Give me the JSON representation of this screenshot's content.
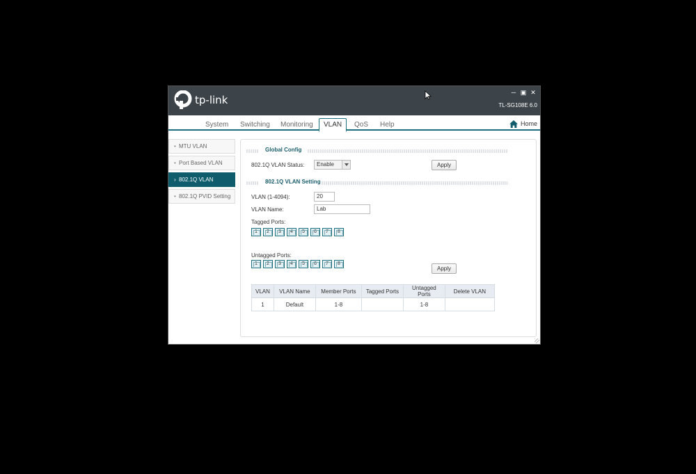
{
  "app": {
    "logo_text": "tp-link",
    "model": "TL-SG108E 6.0",
    "window_controls": [
      "minimize-icon",
      "maximize-icon",
      "close-icon"
    ]
  },
  "nav": {
    "tabs": [
      {
        "label": "System",
        "active": false
      },
      {
        "label": "Switching",
        "active": false
      },
      {
        "label": "Monitoring",
        "active": false
      },
      {
        "label": "VLAN",
        "active": true
      },
      {
        "label": "QoS",
        "active": false
      },
      {
        "label": "Help",
        "active": false
      }
    ],
    "home_label": "Home"
  },
  "sidebar": {
    "items": [
      {
        "label": "MTU VLAN",
        "active": false
      },
      {
        "label": "Port Based VLAN",
        "active": false
      },
      {
        "label": "802.1Q VLAN",
        "active": true
      },
      {
        "label": "802.1Q PVID Setting",
        "active": false
      }
    ]
  },
  "global_config": {
    "title": "Global Config",
    "status_label": "802.1Q VLAN Status:",
    "status_value": "Enable",
    "apply_label": "Apply"
  },
  "vlan_setting": {
    "title": "802.1Q VLAN Setting",
    "vlan_id_label": "VLAN (1-4094):",
    "vlan_id_value": "20",
    "vlan_name_label": "VLAN Name:",
    "vlan_name_value": "Lab",
    "tagged_label": "Tagged Ports:",
    "tagged_ports": [
      "1",
      "2",
      "3",
      "4",
      "5",
      "6",
      "7",
      "8"
    ],
    "untagged_label": "Untagged Ports:",
    "untagged_ports": [
      "1",
      "2",
      "3",
      "4",
      "5",
      "6",
      "7",
      "8"
    ],
    "apply_label": "Apply"
  },
  "vlan_table": {
    "headers": [
      "VLAN",
      "VLAN Name",
      "Member Ports",
      "Tagged Ports",
      "Untagged Ports",
      "Delete VLAN"
    ],
    "rows": [
      [
        "1",
        "Default",
        "1-8",
        "",
        "1-8",
        ""
      ]
    ]
  },
  "colors": {
    "titlebar": "#3d4449",
    "accent": "#1b6f7f",
    "sidebar_active": "#0f5d6c",
    "section_title": "#1b5e6d"
  }
}
